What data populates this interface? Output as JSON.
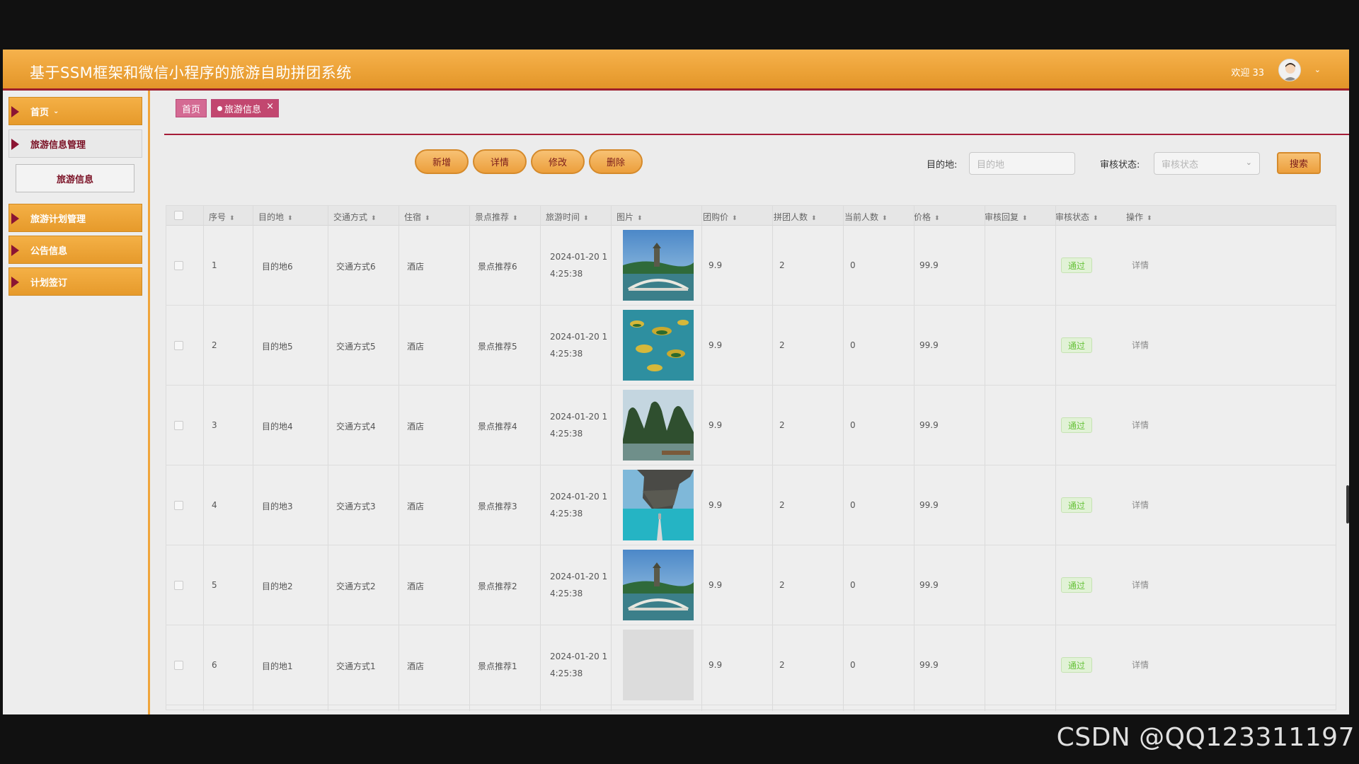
{
  "header": {
    "title": "基于SSM框架和微信小程序的旅游自助拼团系统",
    "welcome": "欢迎 33"
  },
  "sidebar": {
    "items": [
      {
        "label": "首页",
        "style": "orange"
      },
      {
        "label": "旅游信息管理",
        "style": "gray"
      },
      {
        "label": "旅游计划管理",
        "style": "orange"
      },
      {
        "label": "公告信息",
        "style": "orange"
      },
      {
        "label": "计划签订",
        "style": "orange"
      }
    ],
    "submenu": "旅游信息"
  },
  "tabs": {
    "home": "首页",
    "current": "旅游信息",
    "close": "×"
  },
  "toolbar": {
    "add": "新增",
    "detail": "详情",
    "edit": "修改",
    "delete": "删除",
    "dest_label": "目的地:",
    "dest_placeholder": "目的地",
    "status_label": "审核状态:",
    "status_placeholder": "审核状态",
    "search": "搜索"
  },
  "table": {
    "columns": [
      "序号",
      "目的地",
      "交通方式",
      "住宿",
      "景点推荐",
      "旅游时间",
      "图片",
      "团购价",
      "拼团人数",
      "当前人数",
      "价格",
      "审核回复",
      "审核状态",
      "操作"
    ],
    "rows": [
      {
        "no": "1",
        "dest": "目的地6",
        "transport": "交通方式6",
        "hotel": "酒店",
        "spot": "景点推荐6",
        "time1": "2024-01-20 1",
        "time2": "4:25:38",
        "img": "bridge",
        "group_price": "9.9",
        "group_count": "2",
        "current": "0",
        "price": "99.9",
        "reply": "",
        "status": "通过",
        "op": "详情"
      },
      {
        "no": "2",
        "dest": "目的地5",
        "transport": "交通方式5",
        "hotel": "酒店",
        "spot": "景点推荐5",
        "time1": "2024-01-20 1",
        "time2": "4:25:38",
        "img": "islands",
        "group_price": "9.9",
        "group_count": "2",
        "current": "0",
        "price": "99.9",
        "reply": "",
        "status": "通过",
        "op": "详情"
      },
      {
        "no": "3",
        "dest": "目的地4",
        "transport": "交通方式4",
        "hotel": "酒店",
        "spot": "景点推荐4",
        "time1": "2024-01-20 1",
        "time2": "4:25:38",
        "img": "karst",
        "group_price": "9.9",
        "group_count": "2",
        "current": "0",
        "price": "99.9",
        "reply": "",
        "status": "通过",
        "op": "详情"
      },
      {
        "no": "4",
        "dest": "目的地3",
        "transport": "交通方式3",
        "hotel": "酒店",
        "spot": "景点推荐3",
        "time1": "2024-01-20 1",
        "time2": "4:25:38",
        "img": "lagoon",
        "group_price": "9.9",
        "group_count": "2",
        "current": "0",
        "price": "99.9",
        "reply": "",
        "status": "通过",
        "op": "详情"
      },
      {
        "no": "5",
        "dest": "目的地2",
        "transport": "交通方式2",
        "hotel": "酒店",
        "spot": "景点推荐2",
        "time1": "2024-01-20 1",
        "time2": "4:25:38",
        "img": "bridge",
        "group_price": "9.9",
        "group_count": "2",
        "current": "0",
        "price": "99.9",
        "reply": "",
        "status": "通过",
        "op": "详情"
      },
      {
        "no": "6",
        "dest": "目的地1",
        "transport": "交通方式1",
        "hotel": "酒店",
        "spot": "景点推荐1",
        "time1": "2024-01-20 1",
        "time2": "4:25:38",
        "img": "blank",
        "group_price": "9.9",
        "group_count": "2",
        "current": "0",
        "price": "99.9",
        "reply": "",
        "status": "通过",
        "op": "详情"
      }
    ]
  },
  "watermark": "CSDN @QQ123311197"
}
